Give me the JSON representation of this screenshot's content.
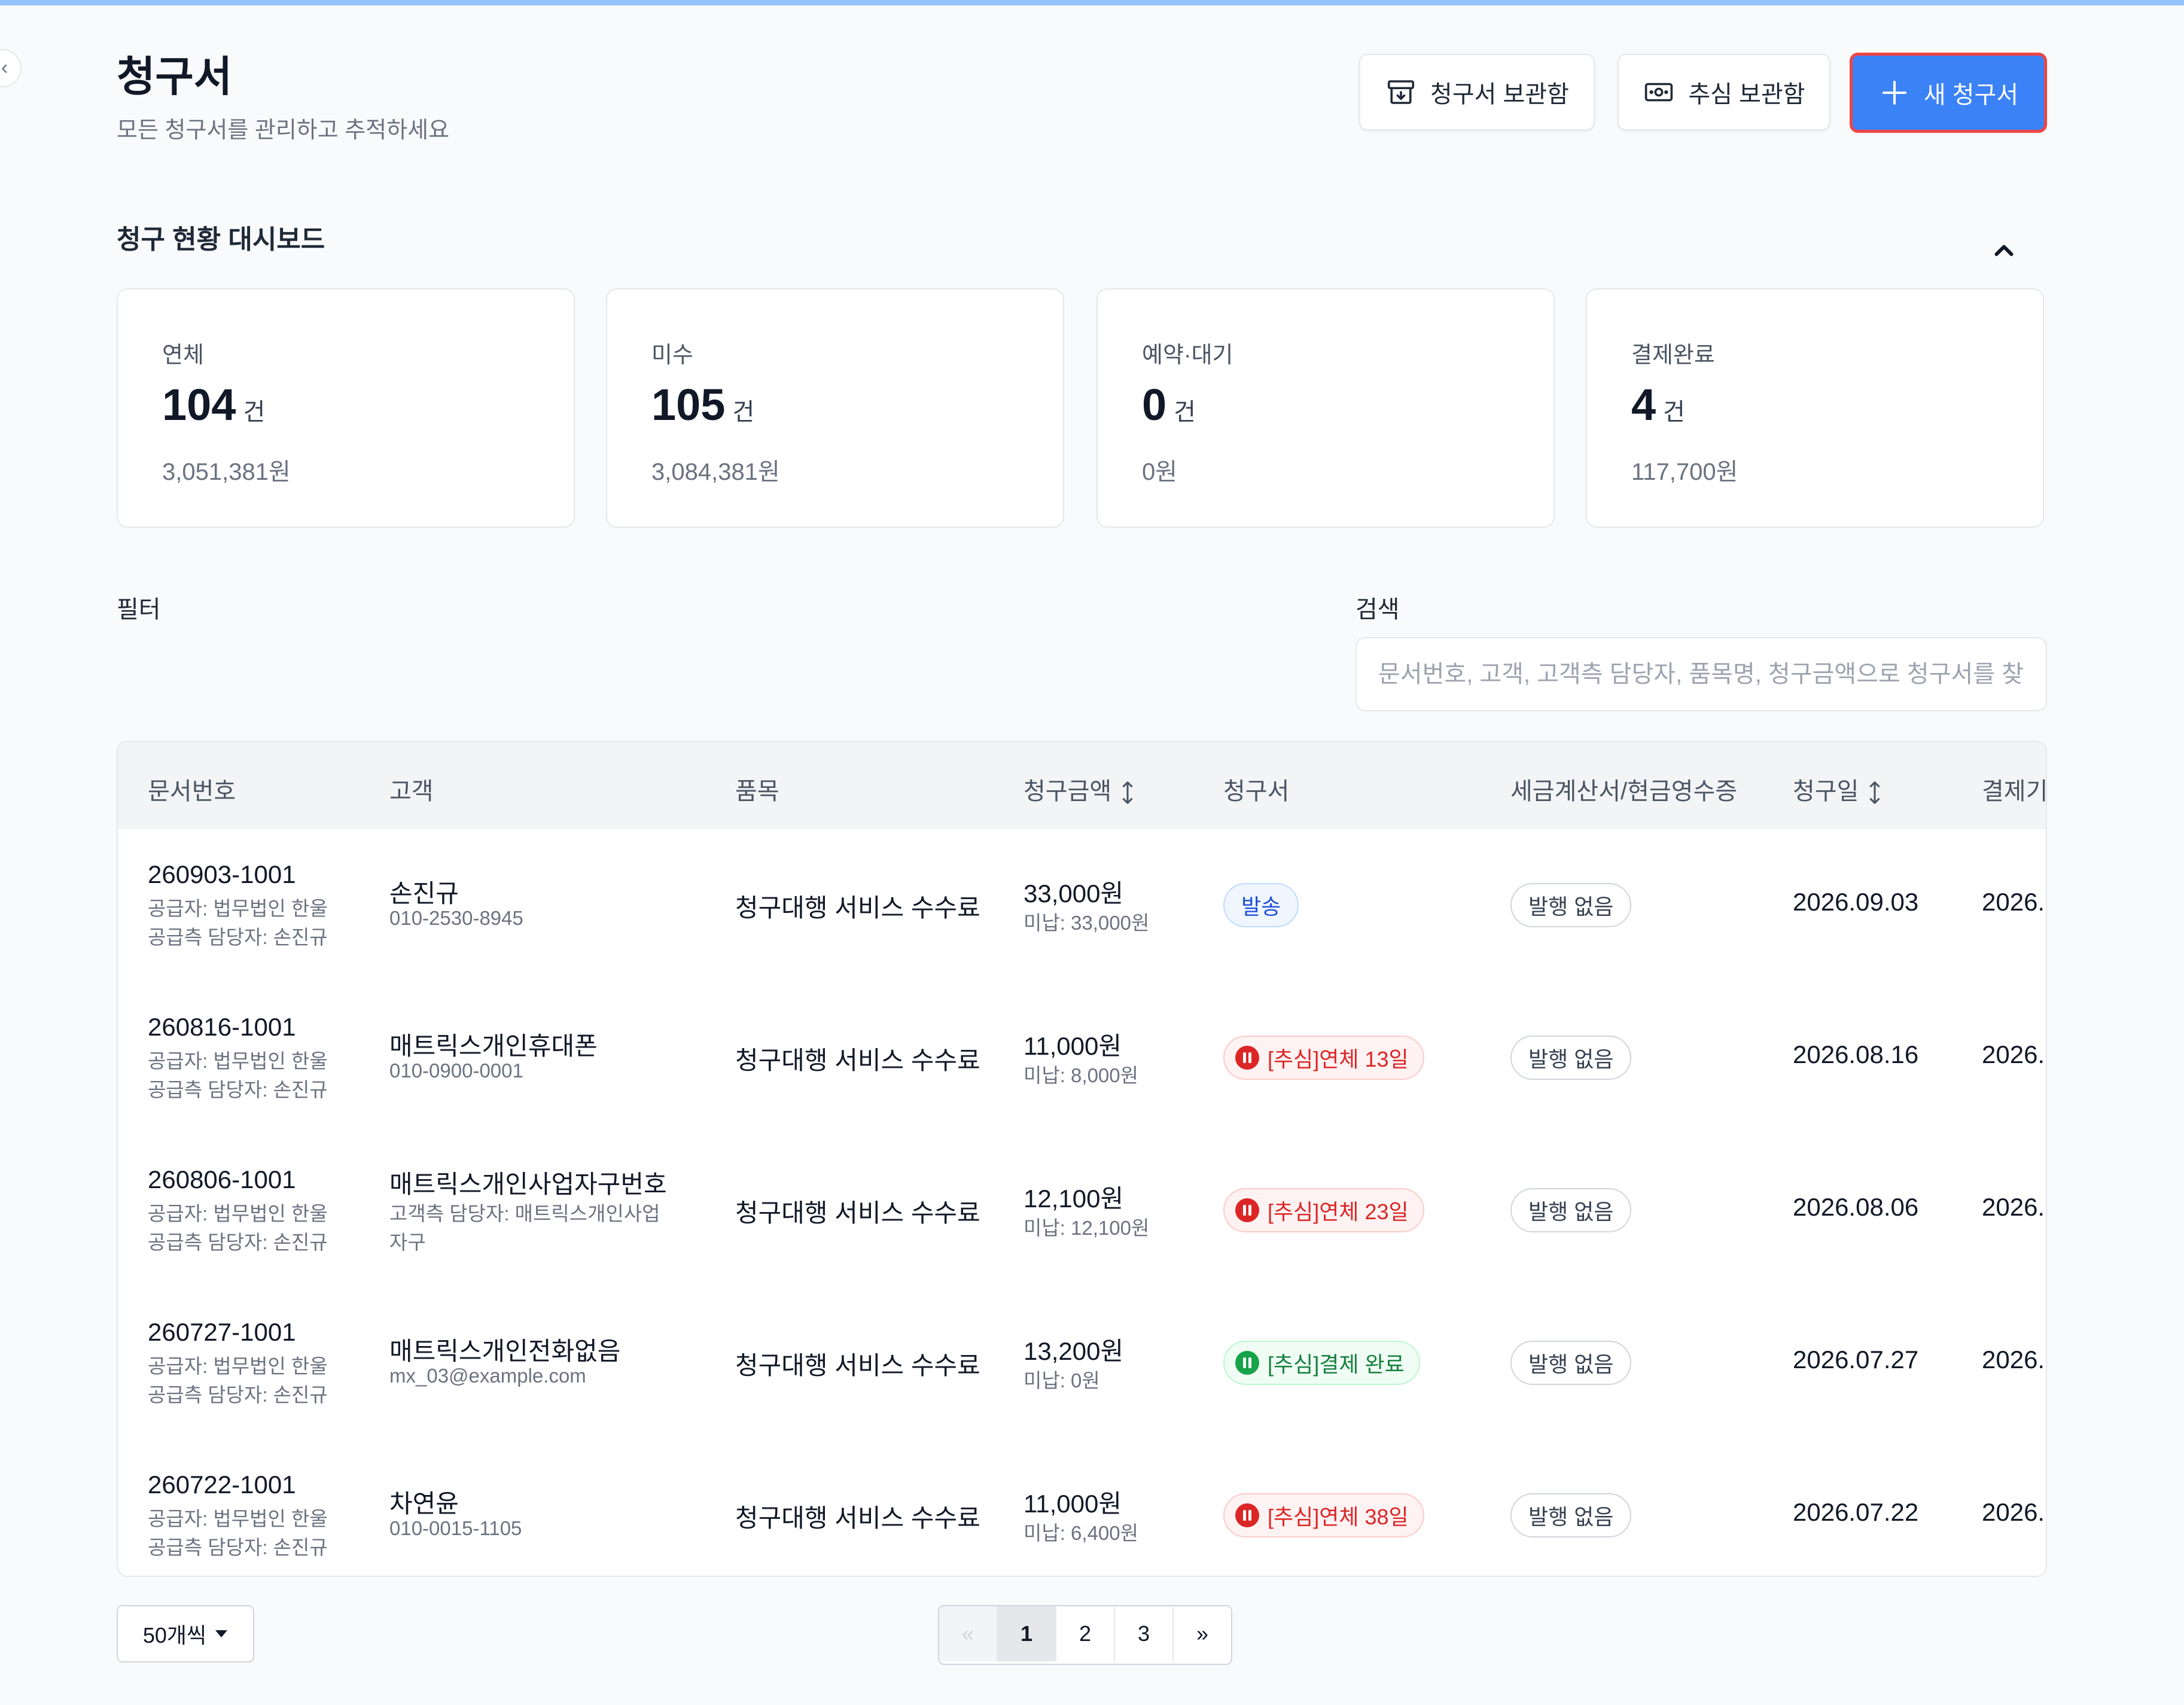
{
  "header": {
    "title": "청구서",
    "subtitle": "모든 청구서를 관리하고 추적하세요",
    "archive_label": "청구서 보관함",
    "collection_label": "추심 보관함",
    "new_label": "새 청구서"
  },
  "dashboard": {
    "title": "청구 현황 대시보드",
    "cards": [
      {
        "label": "연체",
        "count": "104",
        "unit": "건",
        "amount": "3,051,381원"
      },
      {
        "label": "미수",
        "count": "105",
        "unit": "건",
        "amount": "3,084,381원"
      },
      {
        "label": "예약·대기",
        "count": "0",
        "unit": "건",
        "amount": "0원"
      },
      {
        "label": "결제완료",
        "count": "4",
        "unit": "건",
        "amount": "117,700원"
      }
    ]
  },
  "filter": {
    "label": "필터"
  },
  "search": {
    "label": "검색",
    "placeholder": "문서번호, 고객, 고객측 담당자, 품목명, 청구금액으로 청구서를 찾아보세요"
  },
  "table": {
    "headers": {
      "doc_no": "문서번호",
      "customer": "고객",
      "item": "품목",
      "amount": "청구금액",
      "invoice": "청구서",
      "tax": "세금계산서/현금영수증",
      "date": "청구일",
      "due": "결제기한"
    },
    "rows": [
      {
        "doc_no": "260903-1001",
        "supplier": "공급자: 법무법인 한울",
        "supplier_manager": "공급측 담당자: 손진규",
        "customer": "손진규",
        "customer_sub": "010-2530-8945",
        "item": "청구대행 서비스 수수료",
        "amount": "33,000원",
        "unpaid": "미납: 33,000원",
        "status": "발송",
        "tax": "발행 없음",
        "date": "2026.09.03",
        "due": "2026."
      },
      {
        "doc_no": "260816-1001",
        "supplier": "공급자: 법무법인 한울",
        "supplier_manager": "공급측 담당자: 손진규",
        "customer": "매트릭스개인휴대폰",
        "customer_sub": "010-0900-0001",
        "item": "청구대행 서비스 수수료",
        "amount": "11,000원",
        "unpaid": "미납: 8,000원",
        "status": "[추심]연체 13일",
        "tax": "발행 없음",
        "date": "2026.08.16",
        "due": "2026."
      },
      {
        "doc_no": "260806-1001",
        "supplier": "공급자: 법무법인 한울",
        "supplier_manager": "공급측 담당자: 손진규",
        "customer": "매트릭스개인사업자구번호",
        "customer_sub": "고객측 담당자: 매트릭스개인사업",
        "customer_sub2": "자구",
        "item": "청구대행 서비스 수수료",
        "amount": "12,100원",
        "unpaid": "미납: 12,100원",
        "status": "[추심]연체 23일",
        "tax": "발행 없음",
        "date": "2026.08.06",
        "due": "2026."
      },
      {
        "doc_no": "260727-1001",
        "supplier": "공급자: 법무법인 한울",
        "supplier_manager": "공급측 담당자: 손진규",
        "customer": "매트릭스개인전화없음",
        "customer_sub": "mx_03@example.com",
        "item": "청구대행 서비스 수수료",
        "amount": "13,200원",
        "unpaid": "미납: 0원",
        "status": "[추심]결제 완료",
        "tax": "발행 없음",
        "date": "2026.07.27",
        "due": "2026."
      },
      {
        "doc_no": "260722-1001",
        "supplier": "공급자: 법무법인 한울",
        "supplier_manager": "공급측 담당자: 손진규",
        "customer": "차연윤",
        "customer_sub": "010-0015-1105",
        "item": "청구대행 서비스 수수료",
        "amount": "11,000원",
        "unpaid": "미납: 6,400원",
        "status": "[추심]연체 38일",
        "tax": "발행 없음",
        "date": "2026.07.22",
        "due": "2026."
      }
    ]
  },
  "pagination": {
    "per_page": "50개씩",
    "prev": "«",
    "pages": [
      "1",
      "2",
      "3"
    ],
    "next": "»"
  },
  "colors": {
    "primary": "#3b82f6",
    "danger": "#dc2626",
    "success": "#16a34a"
  }
}
